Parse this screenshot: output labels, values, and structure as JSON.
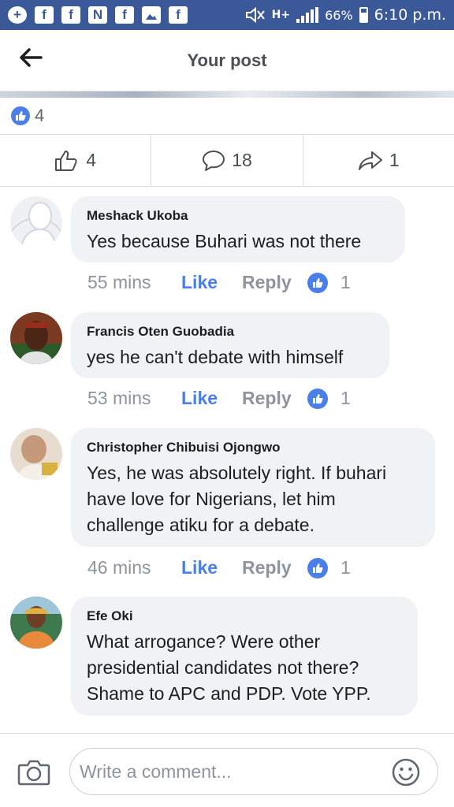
{
  "status_bar": {
    "notif_icons": [
      "add-box-icon",
      "facebook-icon",
      "facebook-icon",
      "news-icon",
      "facebook-icon",
      "gallery-icon",
      "facebook-icon"
    ],
    "network": "H+",
    "battery": "66%",
    "time": "6:10 p.m."
  },
  "header": {
    "title": "Your post"
  },
  "reactions": {
    "count": "4"
  },
  "actions": {
    "likes": "4",
    "comments": "18",
    "shares": "1"
  },
  "comments": [
    {
      "name": "Meshack Ukoba",
      "lines": [
        "Yes because Buhari was not there"
      ],
      "time": "55 mins",
      "like_label": "Like",
      "reply_label": "Reply",
      "reactions": "1"
    },
    {
      "name": "Francis Oten Guobadia",
      "lines": [
        "yes he can't debate with himself"
      ],
      "time": "53 mins",
      "like_label": "Like",
      "reply_label": "Reply",
      "reactions": "1"
    },
    {
      "name": "Christopher Chibuisi Ojongwo",
      "lines": [
        "Yes, he was absolutely right. If buhari",
        "have love for Nigerians, let him",
        "challenge atiku for a debate."
      ],
      "time": "46 mins",
      "like_label": "Like",
      "reply_label": "Reply",
      "reactions": "1"
    },
    {
      "name": "Efe Oki",
      "lines": [
        "What arrogance? Were other",
        "presidential candidates not there?",
        "Shame to APC and PDP.  Vote YPP."
      ],
      "time": "",
      "like_label": "",
      "reply_label": "",
      "reactions": ""
    }
  ],
  "composer": {
    "placeholder": "Write a comment..."
  },
  "colors": {
    "brand": "#3b5998",
    "accent": "#4a7ee8",
    "bubble": "#f0f2f5"
  }
}
